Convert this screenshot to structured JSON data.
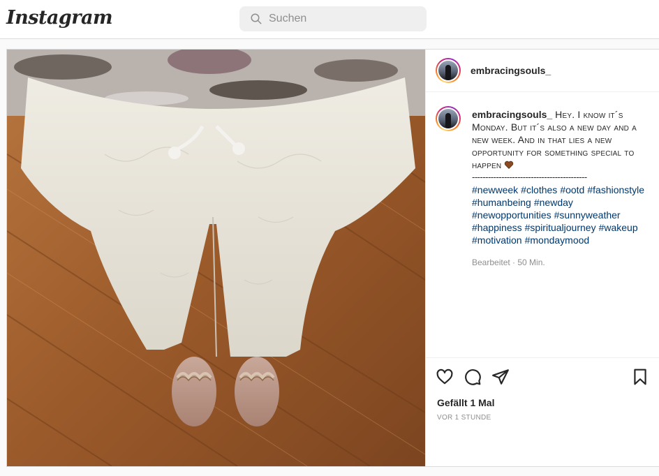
{
  "header": {
    "logo": "Instagram",
    "search_placeholder": "Suchen"
  },
  "post": {
    "author": "embracingsouls_",
    "caption_text": "Hey. I know it´s Monday. But it´s also a new day and a new week. And in that lies a new opportunity for something special to happen",
    "divider": "-------------------------------------------",
    "hashtags": [
      "#newweek",
      "#clothes",
      "#ootd",
      "#fashionstyle",
      "#humanbeing",
      "#newday",
      "#newopportunities",
      "#sunnyweather",
      "#happiness",
      "#spiritualjourney",
      "#wakeup",
      "#motivation",
      "#mondaymood"
    ],
    "edited": "Bearbeitet · 50 Min.",
    "likes": "Gefällt 1 Mal",
    "time": "VOR 1 STUNDE"
  },
  "icons": {
    "search": "search-icon",
    "like": "heart-icon",
    "comment": "comment-icon",
    "share": "paper-plane-icon",
    "save": "bookmark-icon",
    "emoji": "brown-heart-emoji"
  },
  "colors": {
    "link": "#00376b",
    "muted": "#8e8e8e",
    "border": "#dbdbdb"
  }
}
